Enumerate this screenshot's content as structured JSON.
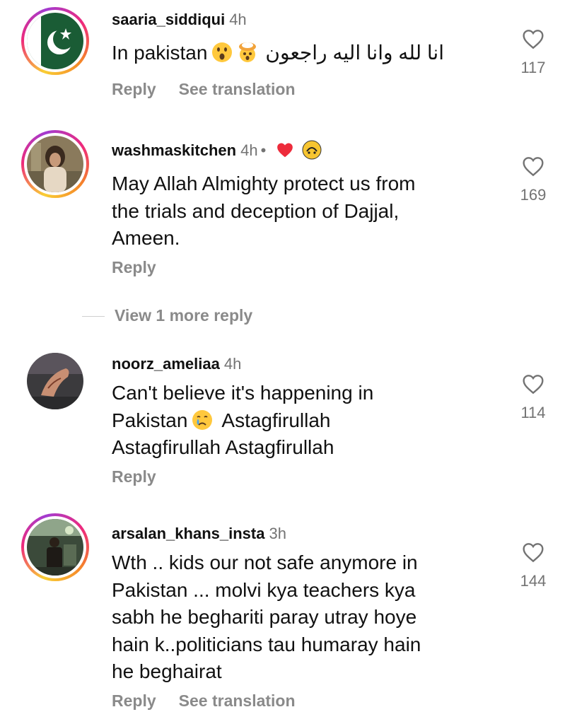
{
  "comments": [
    {
      "username": "saaria_siddiqui",
      "time": "4h",
      "text_before": "In pakistan",
      "emojis": [
        "astonished-face",
        "exploding-head"
      ],
      "text_after_rtl": "انا لله وانا اليه راجعون",
      "reply_label": "Reply",
      "translation_label": "See translation",
      "likes": "117"
    },
    {
      "username": "washmaskitchen",
      "time": "4h",
      "separator": "•",
      "badges": [
        "red-heart",
        "creator-badge"
      ],
      "lines": [
        "May Allah Almighty protect us from",
        "the trials and deception of Dajjal,",
        "Ameen."
      ],
      "reply_label": "Reply",
      "likes": "169",
      "view_more": "View 1 more reply"
    },
    {
      "username": "noorz_ameliaa",
      "time": "4h",
      "line1": "Can't believe it's happening in",
      "line2_before": "Pakistan",
      "line2_emoji": "crying-face",
      "line2_after": "Astagfirullah",
      "line3": "Astagfirullah Astagfirullah",
      "reply_label": "Reply",
      "likes": "114"
    },
    {
      "username": "arsalan_khans_insta",
      "time": "3h",
      "lines": [
        "Wth .. kids our not safe anymore in",
        "Pakistan ... molvi kya teachers kya",
        "sabh he beghariti paray utray hoye",
        "hain k..politicians tau humaray hain",
        "he beghairat"
      ],
      "reply_label": "Reply",
      "translation_label": "See translation",
      "likes": "144"
    }
  ],
  "colors": {
    "text": "#111111",
    "muted": "#737373",
    "action": "#8a8a8a",
    "heart_badge": "#ed2b3b",
    "story_ring": [
      "#f9ce34",
      "#ee2a7b",
      "#a23bd1"
    ]
  }
}
